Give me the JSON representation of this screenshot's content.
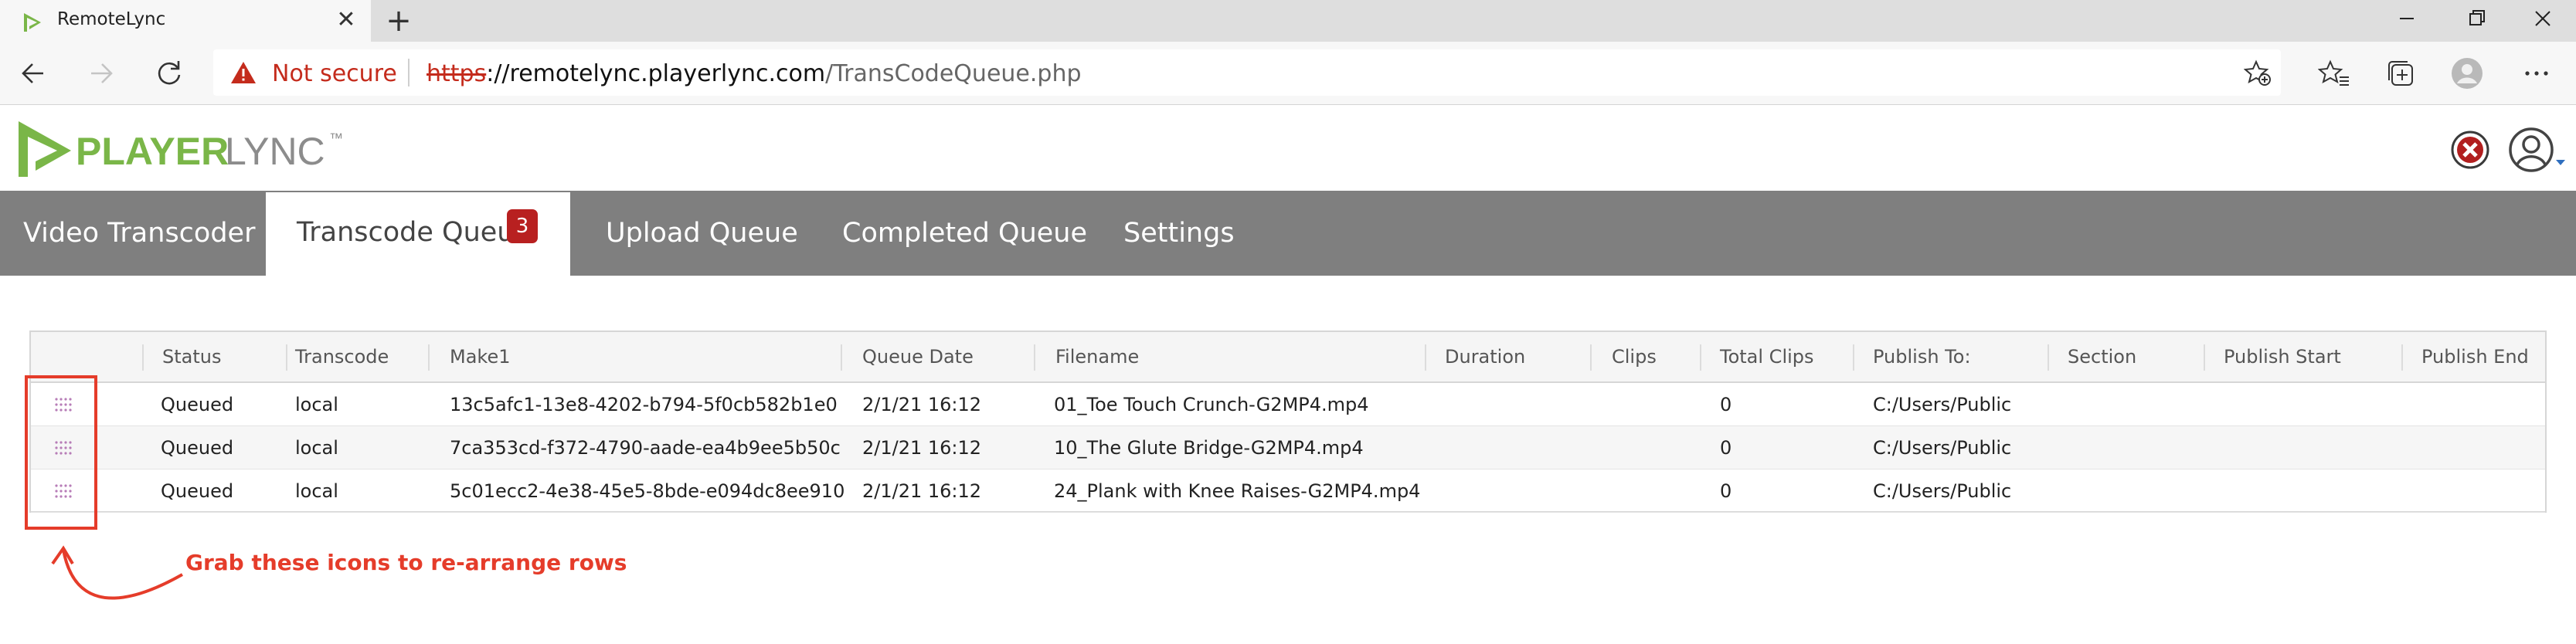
{
  "browser": {
    "tab_title": "RemoteLync",
    "tab_close_glyph": "✕",
    "new_tab_glyph": "+",
    "security_label": "Not secure",
    "url": {
      "scheme": "https",
      "rest": "://remotelync.playerlync.com",
      "path": "/TransCodeQueue.php"
    },
    "icons": {
      "favicon": "playerlync-favicon",
      "back": "arrow-left-icon",
      "forward": "arrow-right-icon",
      "reload": "reload-icon",
      "warning": "warning-triangle-icon",
      "add_favorite": "star-plus-icon",
      "favorites": "favorites-icon",
      "collections": "collections-icon",
      "profile": "profile-icon",
      "more": "more-dots-icon"
    }
  },
  "app": {
    "logo_text": "PLAYERLYNC",
    "logo_tm": "™",
    "brand_green": "#7ab648",
    "brand_gray": "#8c8c8c",
    "nav": {
      "items": [
        {
          "label": "Video Transcoder"
        },
        {
          "label": "Transcode Queue",
          "badge": "3"
        },
        {
          "label": "Upload Queue"
        },
        {
          "label": "Completed Queue"
        },
        {
          "label": "Settings"
        }
      ],
      "active_index": 1
    },
    "header_icons": {
      "close": "close-circle-icon",
      "user": "user-avatar-icon"
    }
  },
  "table": {
    "columns": [
      "Status",
      "Transcode",
      "Make1",
      "Queue Date",
      "Filename",
      "Duration",
      "Clips",
      "Total Clips",
      "Publish To:",
      "Section",
      "Publish Start",
      "Publish End"
    ],
    "rows": [
      {
        "status": "Queued",
        "transcode": "local",
        "make1": "13c5afc1-13e8-4202-b794-5f0cb582b1e0",
        "queue_date": "2/1/21 16:12",
        "filename": "01_Toe Touch Crunch-G2MP4.mp4",
        "duration": "",
        "clips": "",
        "total_clips": "0",
        "publish_to": "C:/Users/Public",
        "section": "",
        "publish_start": "",
        "publish_end": ""
      },
      {
        "status": "Queued",
        "transcode": "local",
        "make1": "7ca353cd-f372-4790-aade-ea4b9ee5b50c",
        "queue_date": "2/1/21 16:12",
        "filename": "10_The Glute Bridge-G2MP4.mp4",
        "duration": "",
        "clips": "",
        "total_clips": "0",
        "publish_to": "C:/Users/Public",
        "section": "",
        "publish_start": "",
        "publish_end": ""
      },
      {
        "status": "Queued",
        "transcode": "local",
        "make1": "5c01ecc2-4e38-45e5-8bde-e094dc8ee910",
        "queue_date": "2/1/21 16:12",
        "filename": "24_Plank with Knee Raises-G2MP4.mp4",
        "duration": "",
        "clips": "",
        "total_clips": "0",
        "publish_to": "C:/Users/Public",
        "section": "",
        "publish_start": "",
        "publish_end": ""
      }
    ],
    "drag_icon": "drag-handle-icon"
  },
  "annotation": {
    "text": "Grab these icons to re-arrange rows",
    "color": "#e53c2a"
  }
}
